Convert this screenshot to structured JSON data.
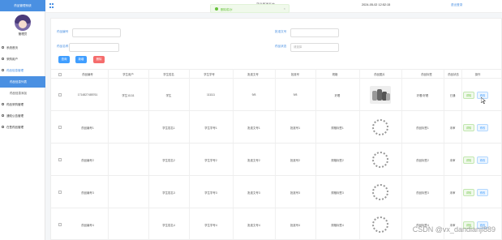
{
  "sidebar": {
    "brand": "药品管理系统",
    "username": "管理员",
    "items": [
      {
        "label": "系统首页"
      },
      {
        "label": "采购用户"
      },
      {
        "label": "药品信息管理"
      },
      {
        "label": "药品信息列表"
      },
      {
        "label": "药品信息添加"
      },
      {
        "label": "药品采购管理"
      },
      {
        "label": "通知公告管理"
      },
      {
        "label": "在售药品管理"
      }
    ]
  },
  "topbar": {
    "title": "药品管理系统",
    "datetime": "2024-05-02 12:52:15",
    "logout": "退出登录"
  },
  "toast": {
    "message": "删除成功!"
  },
  "filters": {
    "f1_label": "药品编号",
    "f2_label": "药品名称",
    "f3_label": "批准文号",
    "f4_label": "药品状态",
    "f4_placeholder": "请选择"
  },
  "buttons": {
    "search": "查询",
    "add": "新增",
    "delete": "删除"
  },
  "table": {
    "headers": [
      "药品编号",
      "学生用户",
      "学生姓名",
      "学生学号",
      "批准文号",
      "批准号",
      "规格",
      "药品图片",
      "药品标签",
      "药品状态",
      "操作"
    ],
    "rows": [
      {
        "cells": [
          "1714827485761",
          "学生11111",
          "学生",
          "111111",
          "9/8",
          "9/8",
          "好看",
          "",
          "好看/好看",
          "已通"
        ],
        "image": "photo"
      },
      {
        "cells": [
          "药品编号1",
          "",
          "学生姓名1",
          "学生学号1",
          "批准文号1",
          "批准号1",
          "规格标签1",
          "",
          "药品标签1",
          "未审"
        ],
        "image": "loading"
      },
      {
        "cells": [
          "药品编号2",
          "",
          "学生姓名2",
          "学生学号2",
          "批准文号2",
          "批准号2",
          "规格标签2",
          "",
          "药品标签2",
          "未审"
        ],
        "image": "loading"
      },
      {
        "cells": [
          "药品编号3",
          "",
          "学生姓名3",
          "学生学号3",
          "批准文号3",
          "批准号3",
          "规格标签3",
          "",
          "药品标签3",
          "未审"
        ],
        "image": "loading"
      },
      {
        "cells": [
          "药品编号4",
          "",
          "学生姓名4",
          "学生学号4",
          "批准文号4",
          "批准号4",
          "规格标签4",
          "",
          "药品标签4",
          "未审"
        ],
        "image": "loading"
      }
    ],
    "action_detail": "详情",
    "action_edit": "修改"
  },
  "watermark": "CSDN @vx_dandianjl889"
}
